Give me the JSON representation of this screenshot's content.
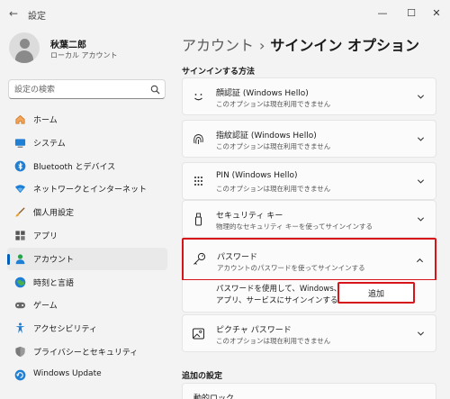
{
  "app": {
    "title": "設定",
    "back_icon": "back-arrow-icon"
  },
  "window_controls": {
    "minimize": "—",
    "maximize": "☐",
    "close": "✕"
  },
  "user": {
    "name": "秋葉二郎",
    "account_type": "ローカル アカウント"
  },
  "search": {
    "placeholder": "設定の検索"
  },
  "sidebar": {
    "items": [
      {
        "label": "ホーム",
        "icon": "home-icon"
      },
      {
        "label": "システム",
        "icon": "system-icon"
      },
      {
        "label": "Bluetooth とデバイス",
        "icon": "bluetooth-icon"
      },
      {
        "label": "ネットワークとインターネット",
        "icon": "network-icon"
      },
      {
        "label": "個人用設定",
        "icon": "brush-icon"
      },
      {
        "label": "アプリ",
        "icon": "apps-icon"
      },
      {
        "label": "アカウント",
        "icon": "account-icon",
        "active": true
      },
      {
        "label": "時刻と言語",
        "icon": "time-language-icon"
      },
      {
        "label": "ゲーム",
        "icon": "gaming-icon"
      },
      {
        "label": "アクセシビリティ",
        "icon": "accessibility-icon"
      },
      {
        "label": "プライバシーとセキュリティ",
        "icon": "shield-icon"
      },
      {
        "label": "Windows Update",
        "icon": "update-icon"
      }
    ]
  },
  "breadcrumb": {
    "parent": "アカウント",
    "separator": "›",
    "current": "サインイン オプション"
  },
  "main": {
    "section_signin": "サインインする方法",
    "section_additional": "追加の設定",
    "options": [
      {
        "title": "顔認証 (Windows Hello)",
        "subtitle": "このオプションは現在利用できません",
        "icon": "face-icon"
      },
      {
        "title": "指紋認証 (Windows Hello)",
        "subtitle": "このオプションは現在利用できません",
        "icon": "fingerprint-icon"
      },
      {
        "title": "PIN (Windows Hello)",
        "subtitle": "このオプションは現在利用できません",
        "icon": "pin-icon"
      },
      {
        "title": "セキュリティ キー",
        "subtitle": "物理的なセキュリティ キーを使ってサインインする",
        "icon": "usb-key-icon"
      },
      {
        "title": "パスワード",
        "subtitle": "アカウントのパスワードを使ってサインインする",
        "icon": "key-icon"
      },
      {
        "title": "ピクチャ パスワード",
        "subtitle": "このオプションは現在利用できません",
        "icon": "picture-icon"
      }
    ],
    "password_expanded": {
      "text": "パスワードを使用して、Windows、アプリ、サービスにサインインする",
      "add_button": "追加"
    },
    "partial_next": "動的ロック"
  },
  "colors": {
    "accent": "#005fb8",
    "highlight": "#d7141a"
  }
}
